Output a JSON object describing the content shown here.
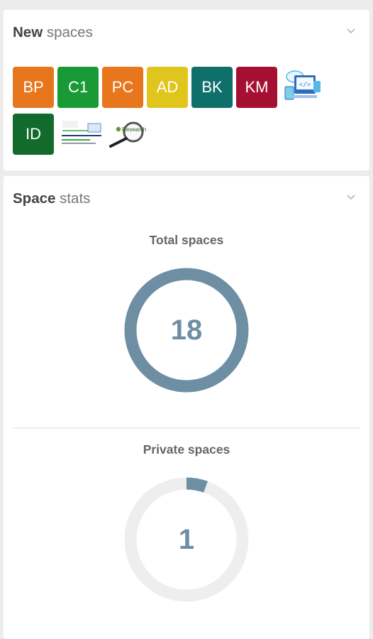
{
  "new_spaces": {
    "title_bold": "New",
    "title_light": "spaces",
    "tiles": [
      {
        "label": "BP",
        "color": "#e8761c"
      },
      {
        "label": "C1",
        "color": "#1a9a36"
      },
      {
        "label": "PC",
        "color": "#e8761c"
      },
      {
        "label": "AD",
        "color": "#e0c51d"
      },
      {
        "label": "BK",
        "color": "#0f6f6a"
      },
      {
        "label": "KM",
        "color": "#a51032"
      },
      {
        "label": "ID",
        "color": "#136b2b"
      }
    ],
    "image_tiles": [
      "code-cloud-icon",
      "banner-thumbnail",
      "research-magnifier-icon"
    ],
    "banner_text": "Educational Institutions\nStudy Reports Circulations",
    "research_text": "Research"
  },
  "space_stats": {
    "title_bold": "Space",
    "title_light": "stats",
    "total": {
      "label": "Total spaces",
      "value": "18",
      "fraction": 1.0
    },
    "private": {
      "label": "Private spaces",
      "value": "1",
      "fraction": 0.0556
    },
    "colors": {
      "ring": "#6e8fa3",
      "track": "#eeeeee"
    }
  }
}
